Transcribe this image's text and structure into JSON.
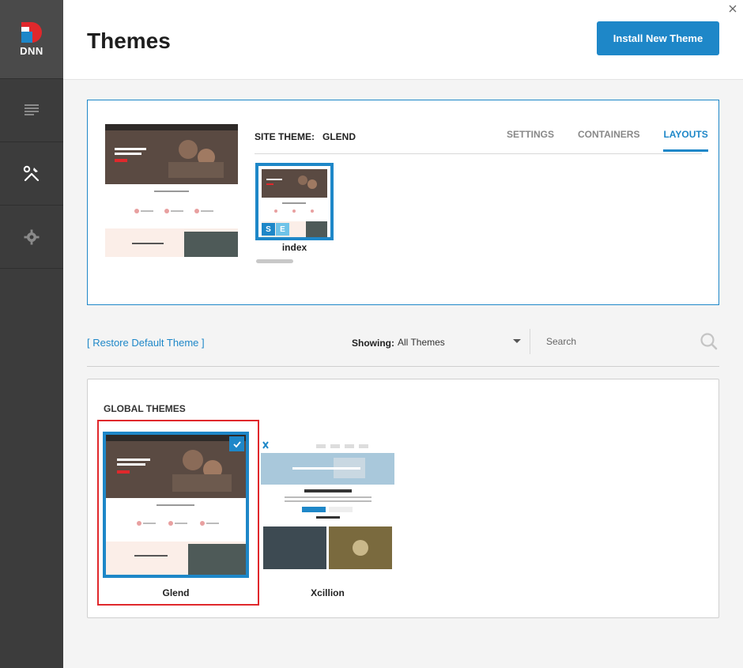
{
  "app": {
    "logo_text": "DNN",
    "icons": [
      "dnn-logo-icon",
      "content-icon",
      "tools-icon",
      "gear-icon",
      "close-icon",
      "search-icon",
      "checkmark-icon"
    ]
  },
  "header": {
    "title": "Themes",
    "install_label": "Install New Theme"
  },
  "site_theme": {
    "label": "SITE THEME:",
    "value": "GLEND",
    "tabs": [
      {
        "label": "SETTINGS",
        "active": false
      },
      {
        "label": "CONTAINERS",
        "active": false
      },
      {
        "label": "LAYOUTS",
        "active": true
      }
    ],
    "layouts": [
      {
        "name": "index",
        "badges": [
          "S",
          "E"
        ]
      }
    ]
  },
  "filters": {
    "restore_label": "[ Restore Default Theme ]",
    "showing_label": "Showing:",
    "showing_value": "All Themes",
    "search_placeholder": "Search"
  },
  "global_themes": {
    "title": "GLOBAL THEMES",
    "themes": [
      {
        "name": "Glend",
        "selected": true
      },
      {
        "name": "Xcillion",
        "selected": false
      }
    ]
  },
  "colors": {
    "accent": "#1e87c8",
    "highlight": "#e0282c",
    "sidebar": "#3c3c3c"
  }
}
